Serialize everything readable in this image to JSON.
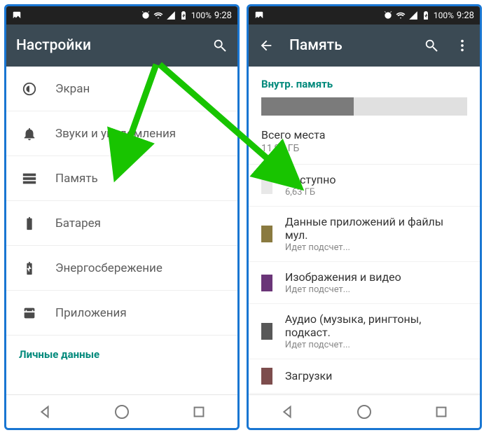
{
  "status": {
    "battery_pct": "100%",
    "time": "9:28"
  },
  "left": {
    "title": "Настройки",
    "items": [
      {
        "icon": "brightness",
        "label": "Экран"
      },
      {
        "icon": "bell",
        "label": "Звуки и уведомления"
      },
      {
        "icon": "storage",
        "label": "Память"
      },
      {
        "icon": "battery",
        "label": "Батарея"
      },
      {
        "icon": "battery-saver",
        "label": "Энергосбережение"
      },
      {
        "icon": "apps",
        "label": "Приложения"
      }
    ],
    "section_personal": "Личные данные"
  },
  "right": {
    "title": "Память",
    "internal_header": "Внутр. память",
    "total_label": "Всего места",
    "total_value": "11,99 ГБ",
    "used_fraction_pct": 45,
    "items": [
      {
        "color": "#e8e8e8",
        "label": "Доступно",
        "sub": "6,63 ГБ"
      },
      {
        "color": "#8a7a40",
        "label": "Данные приложений и файлы мул.",
        "sub": "Идет подсчет..."
      },
      {
        "color": "#6a3578",
        "label": "Изображения и видео",
        "sub": "Идет подсчет..."
      },
      {
        "color": "#585858",
        "label": "Аудио (музыка, рингтоны, подкаст.",
        "sub": "Идет подсчет..."
      },
      {
        "color": "#7d4d4d",
        "label": "Загрузки",
        "sub": ""
      }
    ]
  }
}
